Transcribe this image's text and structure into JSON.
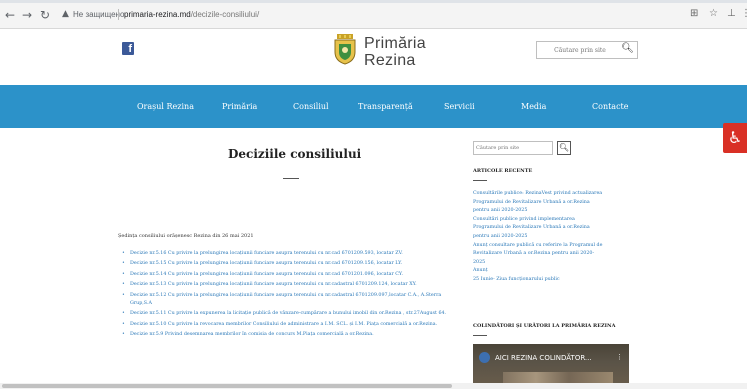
{
  "browser": {
    "security_label": "Не защищено",
    "url_domain": "primaria-rezina.md",
    "url_path": "/decizile-consiliului/"
  },
  "header": {
    "logo_line1": "Primăria",
    "logo_line2": "Rezina",
    "search_placeholder": "Căutare prin site",
    "search_icon": "magnifier-icon",
    "social_icon": "facebook-icon"
  },
  "nav": {
    "items": [
      "Orașul Rezina",
      "Primăria",
      "Consiliul",
      "Transparență",
      "Servicii",
      "Media",
      "Contacte"
    ],
    "color": "#2c92c9"
  },
  "accessibility": {
    "icon": "wheelchair-icon",
    "color": "#d93025"
  },
  "main": {
    "title": "Deciziile consiliului",
    "session": "Ședința consiliului orășenesc Rezina din 26 mai 2021",
    "decisions": [
      "Decizie nr.5.16 Cu privire la prelungirea locațiunii funciare asupra terenului cu nr.cad 6701209.593, locatar ZV.",
      "Decizie nr.5.15 Cu privire la prelungirea locațiunii funciare asupra terenului cu nr.cad 6701209.156, locatar LY.",
      "Decizie nr.5.14 Cu privire la prelungirea locațiunii funciare asupra terenului cu nr.cad 6701201.096, locatar CY.",
      "Decizie nr.5.13 Cu privire la prelungirea locațiunii funciare asupra terenului cu nr.cadastral 6701209.124, locatar XY.",
      "Decizie nr.5.12 Cu privire la prelungirea locațiunii funciare asupra terenului cu nr.cadastral 6701209.097,locatar C.A., A.Sterra Grup,S.A",
      "Decizie nr.5.11 Cu privire la expunerea la licitație publică de vânzare-cumpărare a bunului imobil din or.Rezina , str.27August 64.",
      "Decizie nr.5.10 Cu privire la revocarea membrilor Consiliului de administrare a I.M. SCL. și I.M. Piața comercială a or.Rezina.",
      "Decizie nr.5.9 Privind desemnarea membrilor în comisia de concurs M.Piața comercială a or.Rezina."
    ]
  },
  "sidebar": {
    "search_placeholder": "Căutare prin site",
    "recent_heading": "ARTICOLE RECENTE",
    "recent": [
      "Consultările publice: RezinaVest privind actualizarea",
      "Programului de Revitalizare Urbană a or.Rezina",
      "pentru anii 2020-2025",
      "Consultări publice privind implementarea",
      "Programului de Revitalizare Urbană a or.Rezina",
      "pentru anii 2020-2025",
      "Anunț consultare publică cu referire la Programul de",
      "Revitalizare Urbană a or.Rezina pentru anii 2020-",
      "2025",
      "Anunț",
      "25 Iunie- Ziua funcționarului public"
    ],
    "video_heading": "COLINDĂTORI ȘI URĂTORI LA PRIMĂRIA REZINA",
    "video_title": "AICI REZINA COLINDĂTOR..."
  }
}
